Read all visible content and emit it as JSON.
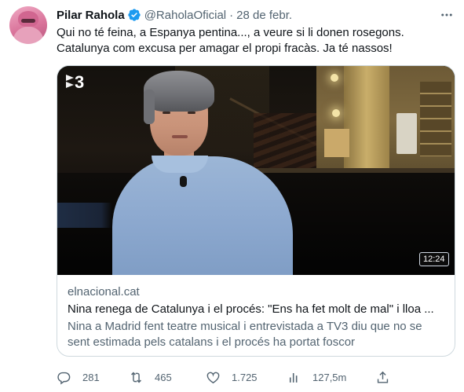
{
  "tweet": {
    "author_name": "Pilar Rahola",
    "handle": "@RaholaOficial",
    "separator": "·",
    "date": "28 de febr.",
    "text": "Qui no té feina, a Espanya pentina..., a veure si li donen rosegons. Catalunya com excusa per amagar el propi fracàs. Ja té nassos!"
  },
  "card": {
    "video_logo": "3",
    "duration": "12:24",
    "domain": "elnacional.cat",
    "title": "Nina renega de Catalunya i el procés: \"Ens ha fet molt de mal\" i lloa ...",
    "description": "Nina a Madrid fent teatre musical i entrevistada a TV3 diu que no se sent estimada pels catalans i el procés ha portat foscor"
  },
  "actions": {
    "replies": "281",
    "retweets": "465",
    "likes": "1.725",
    "views": "127,5m"
  },
  "icons": {
    "verified": "verified-badge-icon",
    "more": "more-horizontal-icon",
    "reply": "reply-icon",
    "retweet": "retweet-icon",
    "like": "heart-icon",
    "views": "views-chart-icon",
    "share": "share-icon"
  },
  "colors": {
    "verified_blue": "#1d9bf0",
    "secondary_text": "#536471",
    "border": "#cfd9de"
  }
}
